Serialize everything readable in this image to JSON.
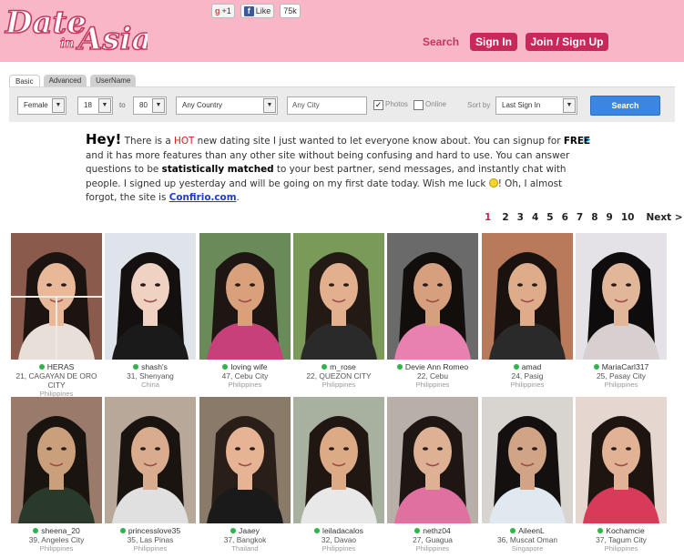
{
  "header": {
    "logo_text_line1": "Date",
    "logo_text_in": "in",
    "logo_text_line2": "Asia",
    "gplus_label": "+1",
    "fb_like_label": "Like",
    "fb_count": "75k",
    "nav_search": "Search",
    "nav_signin": "Sign In",
    "nav_join": "Join / Sign Up",
    "brand_pink": "#f8b6c6",
    "accent": "#c8285a"
  },
  "search": {
    "tabs": [
      "Basic",
      "Advanced",
      "UserName"
    ],
    "gender": "Female",
    "age_from": "18",
    "age_to_label": "to",
    "age_to": "80",
    "country": "Any Country",
    "city_placeholder": "Any City",
    "photos_label": "Photos",
    "online_label": "Online",
    "sort_label": "Sort by",
    "sort_value": "Last Sign In",
    "button": "Search"
  },
  "message": {
    "hey": "Hey!",
    "p1": " There is a ",
    "hot": "HOT",
    "p2": " new dating site I just wanted to let everyone know about. You can signup for ",
    "free": "FREE",
    "p3": " and it has more features than any other site without being confusing and hard to use. You can answer questions to be ",
    "stat": "statistically matched",
    "p4": " to your best partner, send messages, and instantly chat with people. I signed up yesterday and will be going on my first date today. Wish me luck ",
    "p5": "! Oh, I almost forgot, the site is ",
    "link": "Confirio.com",
    "p6": "."
  },
  "pagination": {
    "pages": [
      "1",
      "2",
      "3",
      "4",
      "5",
      "6",
      "7",
      "8",
      "9",
      "10"
    ],
    "current": "1",
    "next": "Next >"
  },
  "profiles": [
    {
      "name": "HERAS",
      "info": "21, CAGAYAN DE ORO CITY",
      "country": "Philippines",
      "bg": "#8a5a4c",
      "skin": "#e8b898",
      "hair": "#1c1410",
      "shirt": "#e8e0d8"
    },
    {
      "name": "shash's",
      "info": "31, Shenyang",
      "country": "China",
      "bg": "#dfe4ea",
      "skin": "#efd2c2",
      "hair": "#141010",
      "shirt": "#1a1a1a"
    },
    {
      "name": "loving wife",
      "info": "47, Cebu City",
      "country": "Philippines",
      "bg": "#6a8a5a",
      "skin": "#d9a07c",
      "hair": "#1e1612",
      "shirt": "#c8407a"
    },
    {
      "name": "m_rose",
      "info": "22, QUEZON CITY",
      "country": "Philippines",
      "bg": "#7a9a5a",
      "skin": "#e2b08e",
      "hair": "#241a14",
      "shirt": "#2a2a2a"
    },
    {
      "name": "Devie Ann Romeo",
      "info": "22, Cebu",
      "country": "Philippines",
      "bg": "#6a6a6a",
      "skin": "#d6a07e",
      "hair": "#120e0c",
      "shirt": "#e880b0"
    },
    {
      "name": "amad",
      "info": "24, Pasig",
      "country": "Philippines",
      "bg": "#b87a5a",
      "skin": "#deac8a",
      "hair": "#1a120e",
      "shirt": "#2a2a2a"
    },
    {
      "name": "MariaCarl317",
      "info": "25, Pasay City",
      "country": "Philippines",
      "bg": "#e4e2e6",
      "skin": "#e2b698",
      "hair": "#0e0c0c",
      "shirt": "#d8d0d0"
    },
    {
      "name": "sheena_20",
      "info": "39, Angeles City",
      "country": "Philippines",
      "bg": "#9a7a6a",
      "skin": "#caa07c",
      "hair": "#1a1410",
      "shirt": "#2a3a2a"
    },
    {
      "name": "princesslove35",
      "info": "35, Las Pinas",
      "country": "Philippines",
      "bg": "#b8a89a",
      "skin": "#d8ac8c",
      "hair": "#1a1410",
      "shirt": "#e0e0e0"
    },
    {
      "name": "Jaaey",
      "info": "37, Bangkok",
      "country": "Thailand",
      "bg": "#8a7a6a",
      "skin": "#e6b494",
      "hair": "#2a1e18",
      "shirt": "#1a1a1a"
    },
    {
      "name": "leiladacalos",
      "info": "32, Davao",
      "country": "Philippines",
      "bg": "#a8b0a0",
      "skin": "#dcaa84",
      "hair": "#201612",
      "shirt": "#e8e8e8"
    },
    {
      "name": "nethz04",
      "info": "27, Guagua",
      "country": "Philippines",
      "bg": "#b8b0a8",
      "skin": "#deb094",
      "hair": "#1e1612",
      "shirt": "#e070a0"
    },
    {
      "name": "AileenL",
      "info": "36, Muscat Oman",
      "country": "Singapore",
      "bg": "#d8d4d0",
      "skin": "#d2a486",
      "hair": "#141010",
      "shirt": "#e0e8f0"
    },
    {
      "name": "Kochamcie",
      "info": "37, Tagum City",
      "country": "Philippines",
      "bg": "#e6d6d0",
      "skin": "#e2b294",
      "hair": "#1e1410",
      "shirt": "#d83a5a"
    }
  ]
}
